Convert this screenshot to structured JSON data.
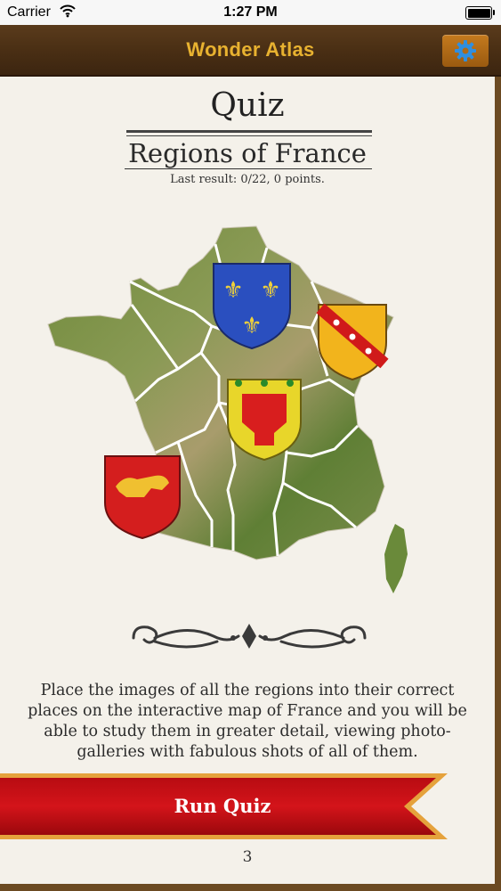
{
  "status_bar": {
    "carrier": "Carrier",
    "time": "1:27 PM"
  },
  "nav": {
    "title": "Wonder Atlas",
    "settings_icon": "gear-icon",
    "accent_color": "#e8b230"
  },
  "page": {
    "title": "Quiz",
    "subtitle": "Regions of France",
    "last_result": "Last result: 0/22, 0 points.",
    "description": "Place the images of all the regions into their correct places on the interactive map of France and you will be able to study them in greater detail, viewing photo-galleries with fabulous shots of all of them.",
    "run_quiz_label": "Run Quiz",
    "page_number": "3"
  },
  "map": {
    "coats_of_arms": [
      "fleur-de-lis-shield",
      "lorraine-shield",
      "auvergne-shield",
      "aquitaine-lion-shield"
    ]
  }
}
